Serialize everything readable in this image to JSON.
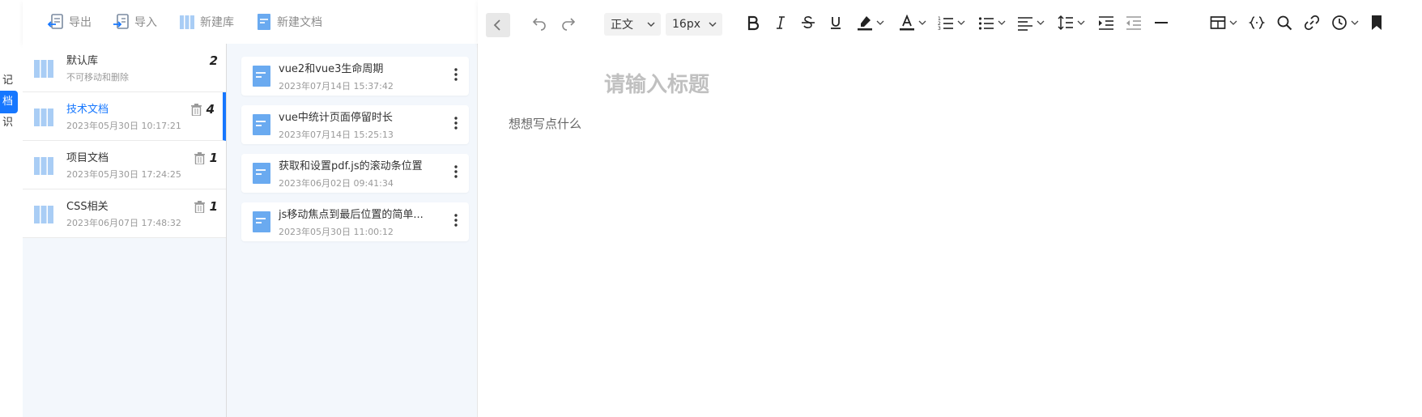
{
  "side_tabs": [
    {
      "label": "记"
    },
    {
      "label": "档"
    },
    {
      "label": "识"
    }
  ],
  "toolbar": {
    "export_label": "导出",
    "import_label": "导入",
    "new_library_label": "新建库",
    "new_document_label": "新建文档"
  },
  "libraries": [
    {
      "name": "默认库",
      "subtitle": "不可移动和删除",
      "count": "2"
    },
    {
      "name": "技术文档",
      "subtitle": "2023年05月30日 10:17:21",
      "count": "4"
    },
    {
      "name": "项目文档",
      "subtitle": "2023年05月30日 17:24:25",
      "count": "1"
    },
    {
      "name": "CSS相关",
      "subtitle": "2023年06月07日 17:48:32",
      "count": "1"
    }
  ],
  "documents": [
    {
      "title": "vue2和vue3生命周期",
      "time": "2023年07月14日 15:37:42"
    },
    {
      "title": "vue中统计页面停留时长",
      "time": "2023年07月14日 15:25:13"
    },
    {
      "title": "获取和设置pdf.js的滚动条位置",
      "time": "2023年06月02日 09:41:34"
    },
    {
      "title": "js移动焦点到最后位置的简单...",
      "time": "2023年05月30日 11:00:12"
    }
  ],
  "editor": {
    "paragraph_style": "正文",
    "font_size": "16px",
    "title_placeholder": "请输入标题",
    "content_placeholder": "想想写点什么"
  },
  "colors": {
    "accent": "#1677ff",
    "doc_icon": "#6aaaf0",
    "lib_icon": "#a9cdf5"
  }
}
